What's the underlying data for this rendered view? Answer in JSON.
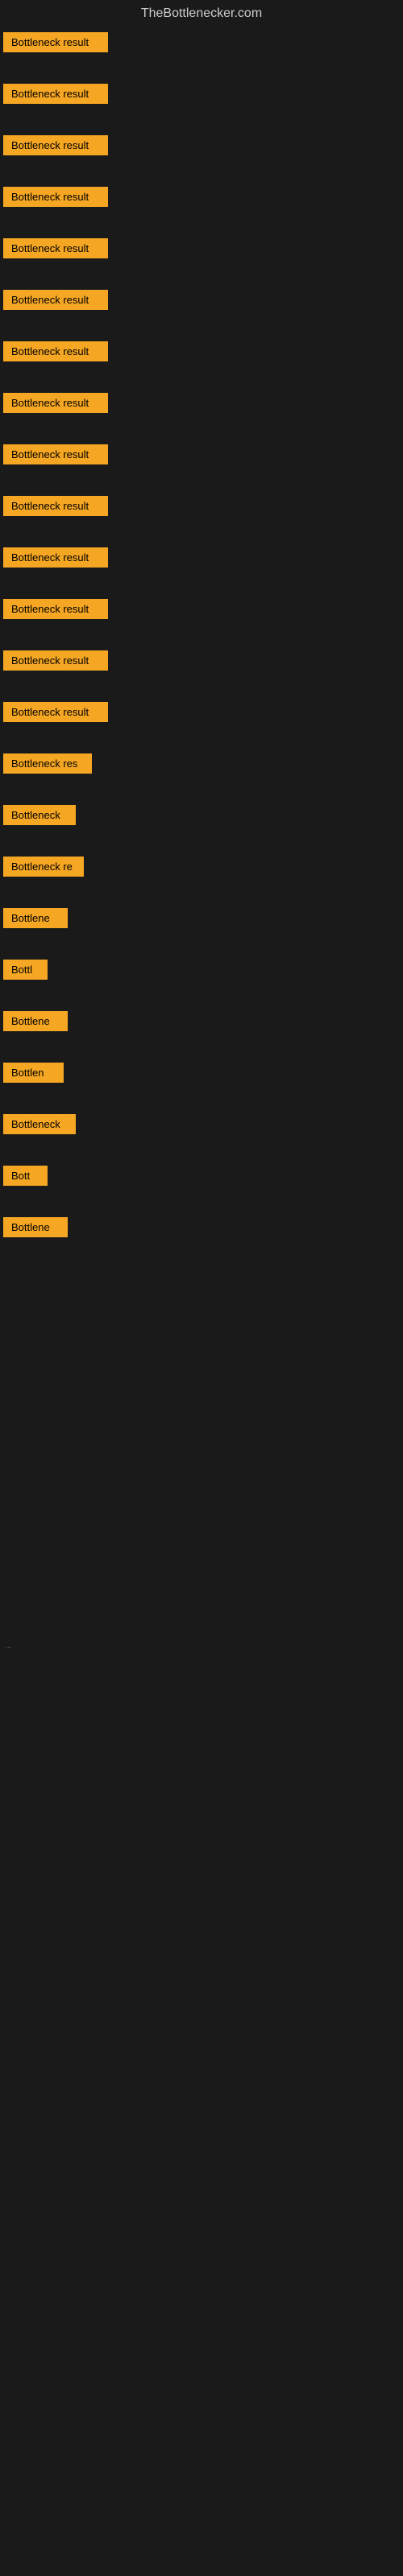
{
  "site": {
    "title": "TheBottlenecker.com"
  },
  "badges": [
    {
      "id": 1,
      "label": "Bottleneck result",
      "width": 130
    },
    {
      "id": 2,
      "label": "Bottleneck result",
      "width": 130
    },
    {
      "id": 3,
      "label": "Bottleneck result",
      "width": 130
    },
    {
      "id": 4,
      "label": "Bottleneck result",
      "width": 130
    },
    {
      "id": 5,
      "label": "Bottleneck result",
      "width": 130
    },
    {
      "id": 6,
      "label": "Bottleneck result",
      "width": 130
    },
    {
      "id": 7,
      "label": "Bottleneck result",
      "width": 130
    },
    {
      "id": 8,
      "label": "Bottleneck result",
      "width": 130
    },
    {
      "id": 9,
      "label": "Bottleneck result",
      "width": 130
    },
    {
      "id": 10,
      "label": "Bottleneck result",
      "width": 130
    },
    {
      "id": 11,
      "label": "Bottleneck result",
      "width": 130
    },
    {
      "id": 12,
      "label": "Bottleneck result",
      "width": 130
    },
    {
      "id": 13,
      "label": "Bottleneck result",
      "width": 130
    },
    {
      "id": 14,
      "label": "Bottleneck result",
      "width": 130
    },
    {
      "id": 15,
      "label": "Bottleneck res",
      "width": 110
    },
    {
      "id": 16,
      "label": "Bottleneck",
      "width": 90
    },
    {
      "id": 17,
      "label": "Bottleneck re",
      "width": 100
    },
    {
      "id": 18,
      "label": "Bottlene",
      "width": 80
    },
    {
      "id": 19,
      "label": "Bottl",
      "width": 60
    },
    {
      "id": 20,
      "label": "Bottlene",
      "width": 80
    },
    {
      "id": 21,
      "label": "Bottlen",
      "width": 75
    },
    {
      "id": 22,
      "label": "Bottleneck",
      "width": 90
    },
    {
      "id": 23,
      "label": "Bott",
      "width": 55
    },
    {
      "id": 24,
      "label": "Bottlene",
      "width": 80
    }
  ],
  "ellipsis": "...",
  "colors": {
    "badge_bg": "#f5a623",
    "badge_text": "#000000",
    "background": "#1a1a1a",
    "title_text": "#cccccc"
  }
}
